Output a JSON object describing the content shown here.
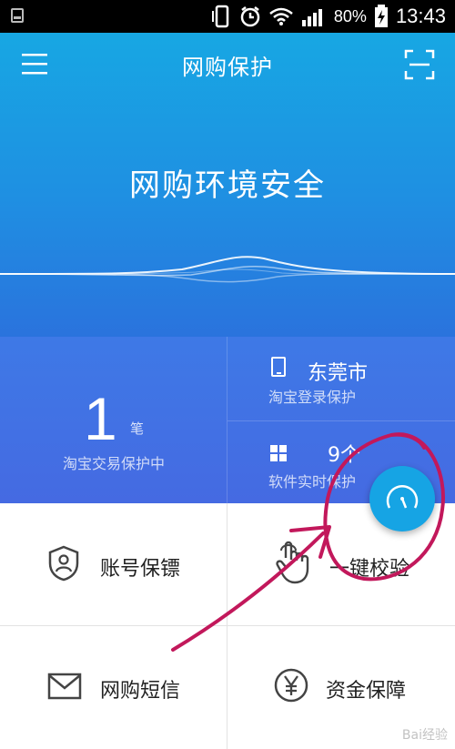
{
  "status_bar": {
    "battery_percent": "80%",
    "time": "13:43"
  },
  "header": {
    "title": "网购保护",
    "menu_icon": "hamburger-menu-icon",
    "scan_icon": "scan-icon"
  },
  "hero": {
    "headline": "网购环境安全"
  },
  "stats": {
    "transactions": {
      "value": "1",
      "unit": "笔",
      "caption": "淘宝交易保护中"
    },
    "login": {
      "icon": "phone-icon",
      "value": "东莞市",
      "caption": "淘宝登录保护"
    },
    "software": {
      "icon": "windows-grid-icon",
      "value": "9个",
      "caption": "软件实时保护"
    }
  },
  "features": [
    {
      "label": "账号保镖",
      "icon": "shield-user-icon"
    },
    {
      "label": "一键校验",
      "icon": "hand-touch-icon"
    },
    {
      "label": "网购短信",
      "icon": "envelope-icon"
    },
    {
      "label": "资金保障",
      "icon": "yen-circle-icon"
    }
  ],
  "fab": {
    "icon": "speedometer-icon"
  },
  "colors": {
    "hero_top": "#17a7e3",
    "hero_bottom": "#2a73dd",
    "stats_bg": "#4170e4",
    "fab": "#16a4e4",
    "annotation": "#c2185b"
  },
  "watermark": "Bai经验"
}
